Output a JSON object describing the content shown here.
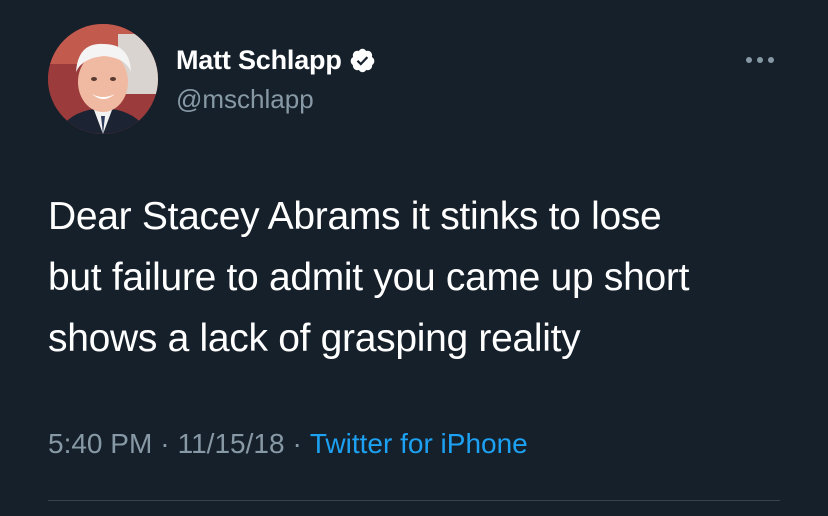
{
  "tweet": {
    "author": {
      "display_name": "Matt Schlapp",
      "handle": "@mschlapp",
      "verified": true,
      "avatar_icon": "profile-photo"
    },
    "more_icon": "more-options-icon",
    "text_lines": [
      "Dear Stacey Abrams it stinks to lose",
      "but failure to admit you came up short",
      "shows a lack of grasping reality"
    ],
    "time": "5:40 PM",
    "separator": "·",
    "date": "11/15/18",
    "source": "Twitter for iPhone"
  },
  "colors": {
    "background": "#15202b",
    "primary_text": "#ffffff",
    "secondary_text": "#8899a6",
    "accent": "#1da1f2",
    "divider": "#38444d"
  }
}
